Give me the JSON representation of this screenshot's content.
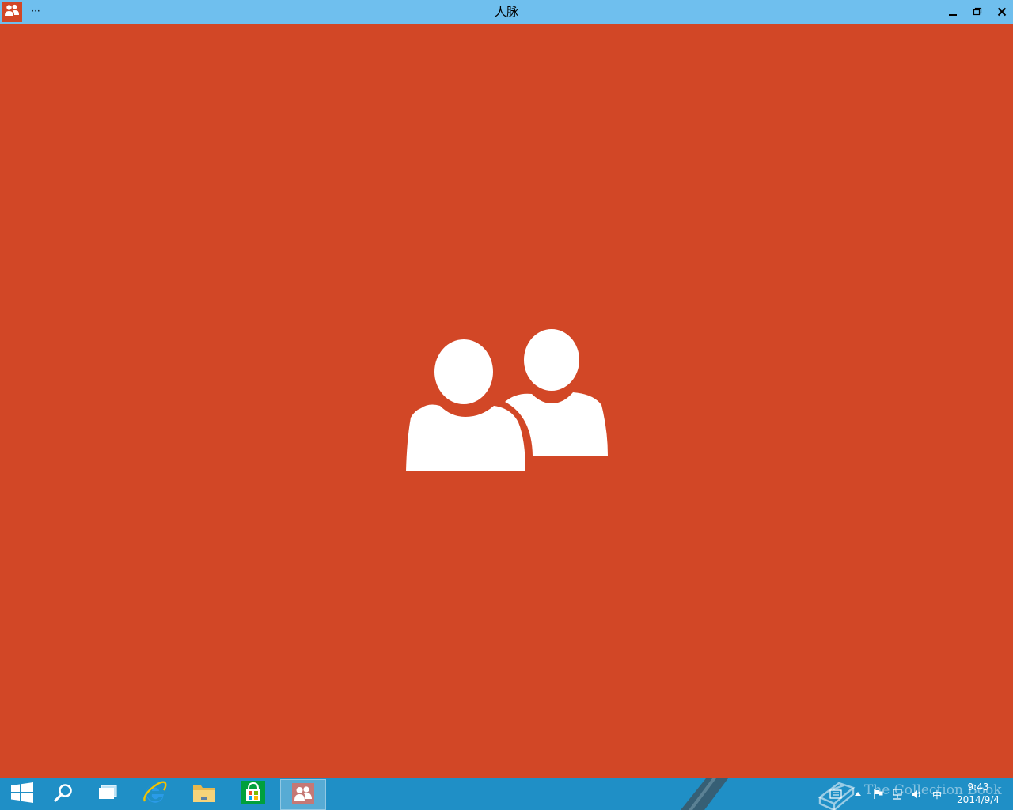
{
  "window": {
    "title": "人脉",
    "menu_label": "···",
    "background_color": "#d24726",
    "titlebar_color": "#6fbfee",
    "icons": {
      "app": "people-icon",
      "minimize": "minimize-icon",
      "maximize": "restore-icon",
      "close": "close-icon"
    }
  },
  "splash": {
    "icon": "people-icon"
  },
  "taskbar": {
    "background_color": "#1f8fc6",
    "items": [
      {
        "name": "start-button",
        "icon": "windows-logo-icon"
      },
      {
        "name": "search-button",
        "icon": "search-icon"
      },
      {
        "name": "task-view-button",
        "icon": "task-view-icon"
      },
      {
        "name": "internet-explorer-button",
        "icon": "internet-explorer-icon"
      },
      {
        "name": "file-explorer-button",
        "icon": "folder-icon"
      },
      {
        "name": "store-button",
        "icon": "store-icon"
      },
      {
        "name": "people-app-button",
        "icon": "people-icon",
        "active": true
      }
    ],
    "tray": {
      "icons": [
        "message-icon",
        "show-hidden-icons-icon",
        "flag-icon",
        "network-icon",
        "volume-icon"
      ],
      "ime_label": "中",
      "clock_time": "9:43",
      "clock_date": "2014/9/4"
    },
    "watermark": "The Collection Book"
  }
}
